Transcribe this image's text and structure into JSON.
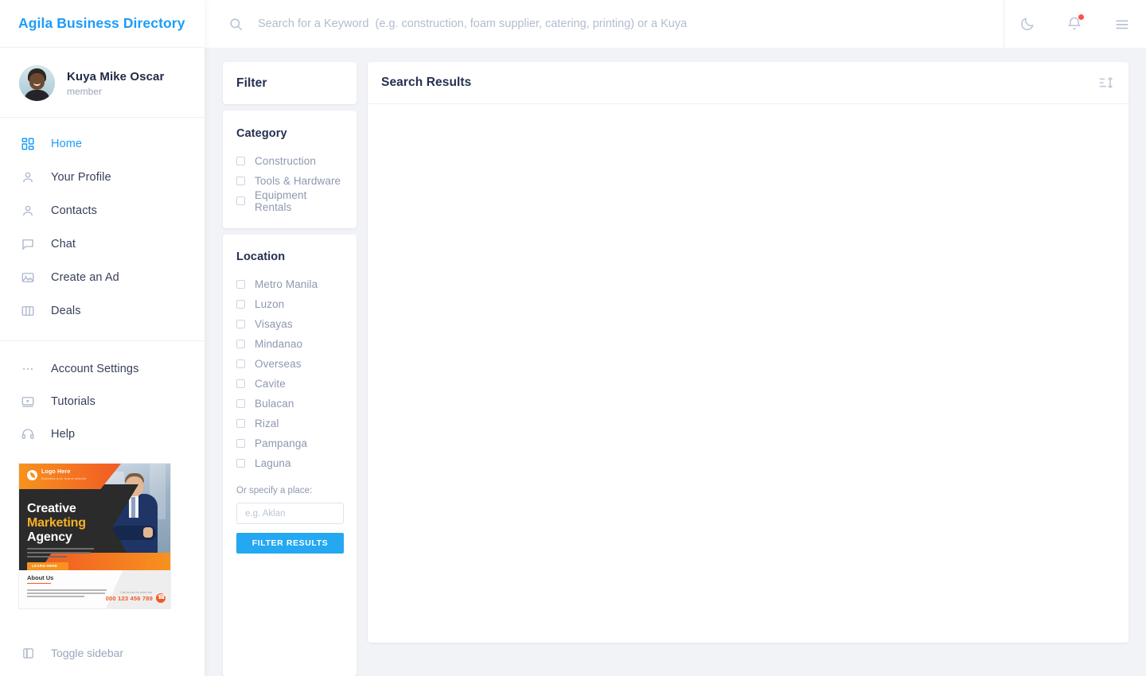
{
  "brand": {
    "title": "Agila Business Directory"
  },
  "user": {
    "name": "Kuya Mike Oscar",
    "role": "member"
  },
  "sidebar": {
    "primary_items": [
      {
        "label": "Home",
        "icon": "grid-icon",
        "active": true
      },
      {
        "label": "Your Profile",
        "icon": "user-icon",
        "active": false
      },
      {
        "label": "Contacts",
        "icon": "user-icon",
        "active": false
      },
      {
        "label": "Chat",
        "icon": "chat-bubble-icon",
        "active": false
      },
      {
        "label": "Create an Ad",
        "icon": "image-icon",
        "active": false
      },
      {
        "label": "Deals",
        "icon": "columns-icon",
        "active": false
      }
    ],
    "secondary_items": [
      {
        "label": "Account Settings",
        "icon": "ellipsis-icon"
      },
      {
        "label": "Tutorials",
        "icon": "video-play-icon"
      },
      {
        "label": "Help",
        "icon": "headset-icon"
      }
    ],
    "toggle_label": "Toggle sidebar",
    "ad": {
      "logo_text": "Logo Here",
      "logo_sub": "Business your brand website",
      "headline_1": "Creative",
      "headline_2": "Marketing",
      "headline_3": "Agency",
      "cta_label": "LEARN HERE",
      "about_title": "About Us",
      "phone_caption": "Call us now for more info",
      "phone": "000 123 456 789"
    }
  },
  "topbar": {
    "search_placeholder": "Search for a Keyword  (e.g. construction, foam supplier, catering, printing) or a Kuya",
    "search_value": "",
    "dark_mode_icon": "moon-icon",
    "notifications_icon": "bell-icon",
    "menu_icon": "hamburger-menu-icon",
    "has_notification": true
  },
  "filter": {
    "panel_title": "Filter",
    "category": {
      "title": "Category",
      "options": [
        {
          "label": "Construction",
          "checked": false
        },
        {
          "label": "Tools & Hardware",
          "checked": false
        },
        {
          "label": "Equipment Rentals",
          "checked": false
        }
      ]
    },
    "location": {
      "title": "Location",
      "options": [
        {
          "label": "Metro Manila",
          "checked": false
        },
        {
          "label": "Luzon",
          "checked": false
        },
        {
          "label": "Visayas",
          "checked": false
        },
        {
          "label": "Mindanao",
          "checked": false
        },
        {
          "label": "Overseas",
          "checked": false
        },
        {
          "label": "Cavite",
          "checked": false
        },
        {
          "label": "Bulacan",
          "checked": false
        },
        {
          "label": "Rizal",
          "checked": false
        },
        {
          "label": "Pampanga",
          "checked": false
        },
        {
          "label": "Laguna",
          "checked": false
        }
      ],
      "specify_label": "Or specify a place:",
      "place_placeholder": "e.g. Aklan",
      "place_value": "",
      "submit_label": "FILTER RESULTS"
    }
  },
  "results": {
    "title": "Search Results",
    "sort_icon": "sort-icon",
    "items": []
  },
  "colors": {
    "accent": "#1b9cfc",
    "button": "#24a8f2",
    "text_dark": "#253052",
    "text_muted": "#8e98b0",
    "page_bg": "#f2f3f7",
    "notification": "#ff4d4d"
  }
}
